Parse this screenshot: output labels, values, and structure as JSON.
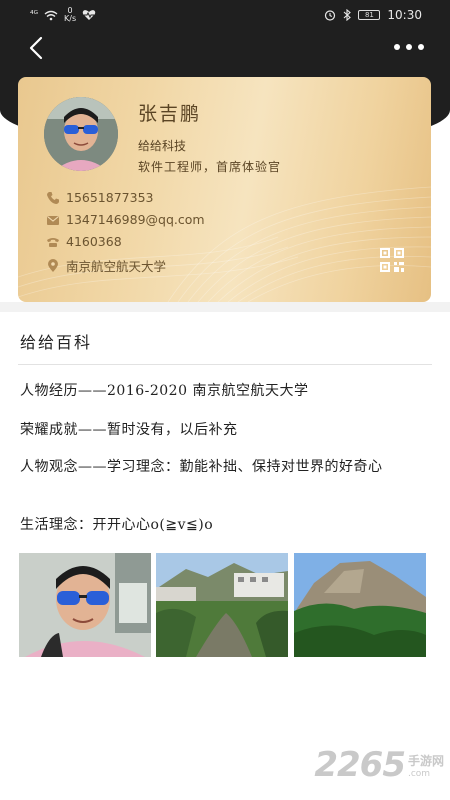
{
  "status_bar": {
    "signal": "⁴ᴳ",
    "net_speed_value": "0",
    "net_speed_unit": "K/s",
    "battery": "81",
    "time": "10:30"
  },
  "profile": {
    "name": "张吉鹏",
    "company": "给给科技",
    "title": "软件工程师，首席体验官",
    "phone": "15651877353",
    "email": "1347146989@qq.com",
    "tel": "4160368",
    "address": "南京航空航天大学"
  },
  "baike": {
    "title": "给给百科",
    "experience": "人物经历——2016-2020 南京航空航天大学",
    "honor": "荣耀成就——暂时没有，以后补充",
    "view": "人物观念——学习理念：勤能补拙、保持对世界的好奇心",
    "life": "生活理念：开开心心o(≧v≦)o"
  },
  "watermark": {
    "number": "2265",
    "site_cn": "手游网",
    "site_en": ".com"
  },
  "colors": {
    "header": "#1f1f1f",
    "card_gold": "#f0d39f",
    "card_text": "#5a4424"
  }
}
